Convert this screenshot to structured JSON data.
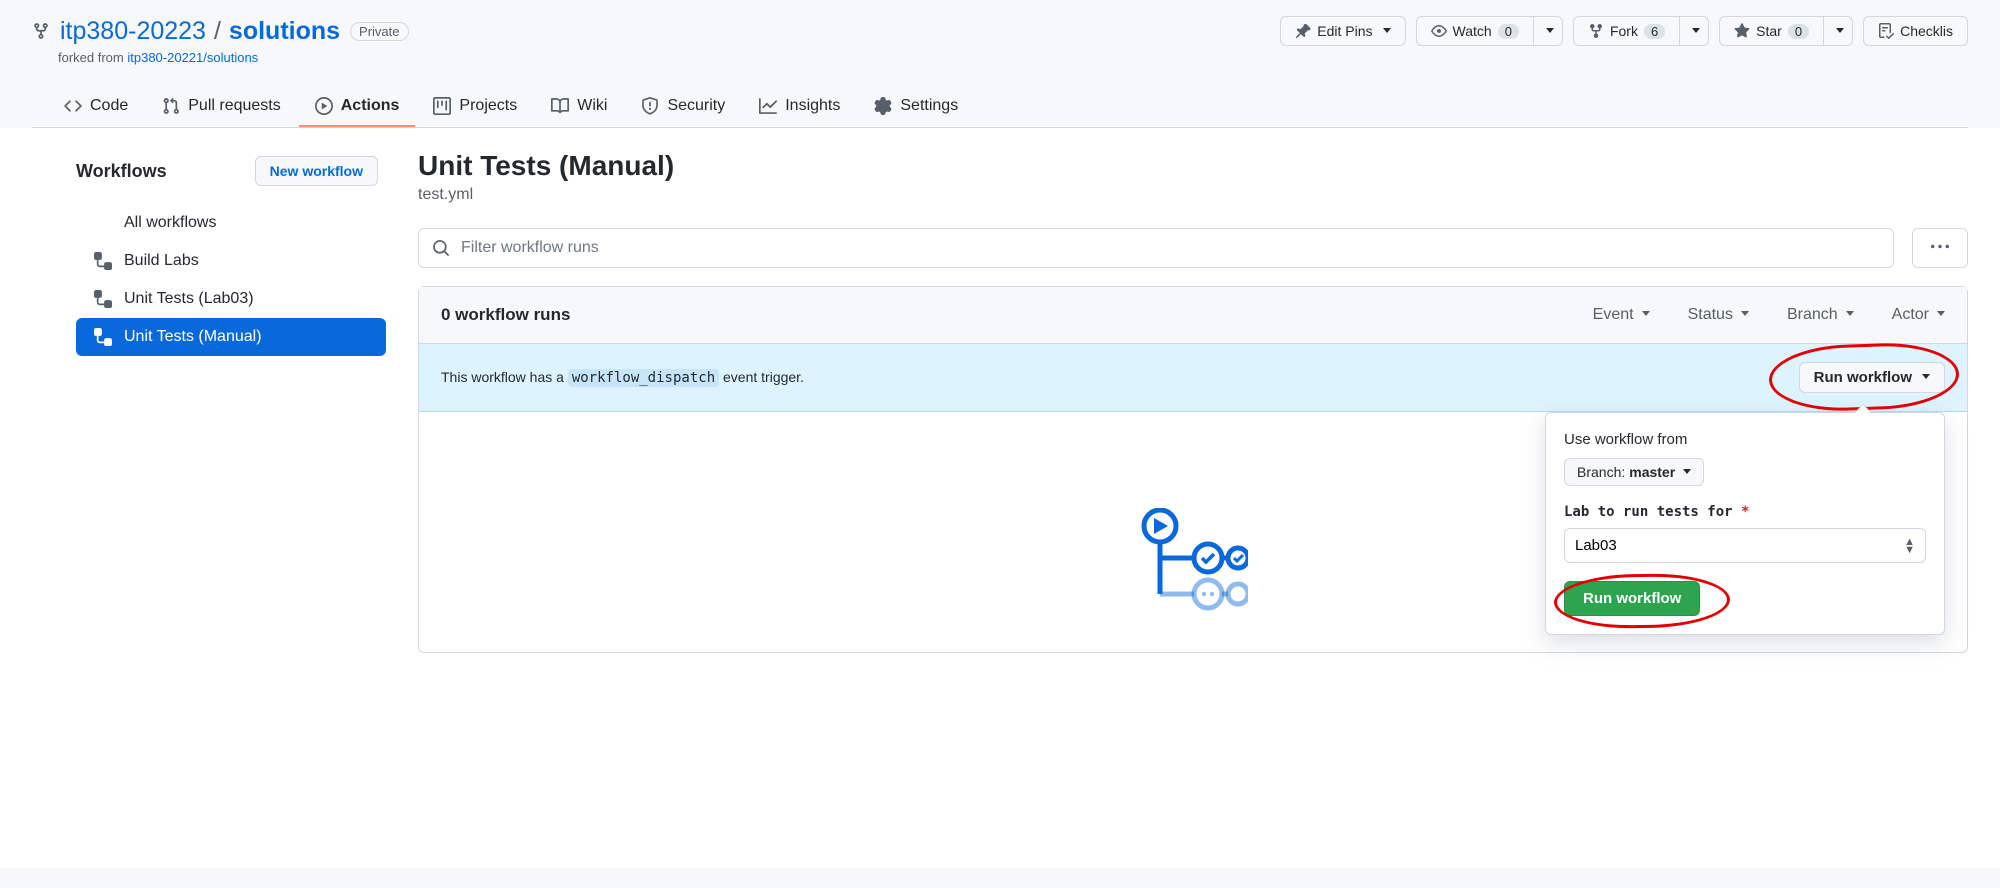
{
  "repo": {
    "owner": "itp380-20223",
    "slash": " / ",
    "name": "solutions",
    "private_label": "Private",
    "forked_from_prefix": "forked from ",
    "forked_from_link": "itp380-20221/solutions"
  },
  "actions": {
    "edit_pins": "Edit Pins",
    "watch": "Watch",
    "watch_count": "0",
    "fork": "Fork",
    "fork_count": "6",
    "star": "Star",
    "star_count": "0",
    "checklist": "Checklis"
  },
  "nav": {
    "code": "Code",
    "pulls": "Pull requests",
    "actions": "Actions",
    "projects": "Projects",
    "wiki": "Wiki",
    "security": "Security",
    "insights": "Insights",
    "settings": "Settings"
  },
  "sidebar": {
    "heading": "Workflows",
    "new_workflow": "New workflow",
    "items": [
      {
        "label": "All workflows"
      },
      {
        "label": "Build Labs"
      },
      {
        "label": "Unit Tests (Lab03)"
      },
      {
        "label": "Unit Tests (Manual)"
      }
    ]
  },
  "main": {
    "title": "Unit Tests (Manual)",
    "file": "test.yml",
    "filter_placeholder": "Filter workflow runs",
    "runs_count": "0 workflow runs",
    "filters": {
      "event": "Event",
      "status": "Status",
      "branch": "Branch",
      "actor": "Actor"
    },
    "dispatch_text_pre": "This workflow has a ",
    "dispatch_code": "workflow_dispatch",
    "dispatch_text_post": " event trigger.",
    "run_workflow_btn": "Run workflow"
  },
  "popover": {
    "use_from": "Use workflow from",
    "branch_prefix": "Branch: ",
    "branch_name": "master",
    "lab_label": "Lab to run tests for ",
    "lab_value": "Lab03",
    "submit": "Run workflow"
  }
}
